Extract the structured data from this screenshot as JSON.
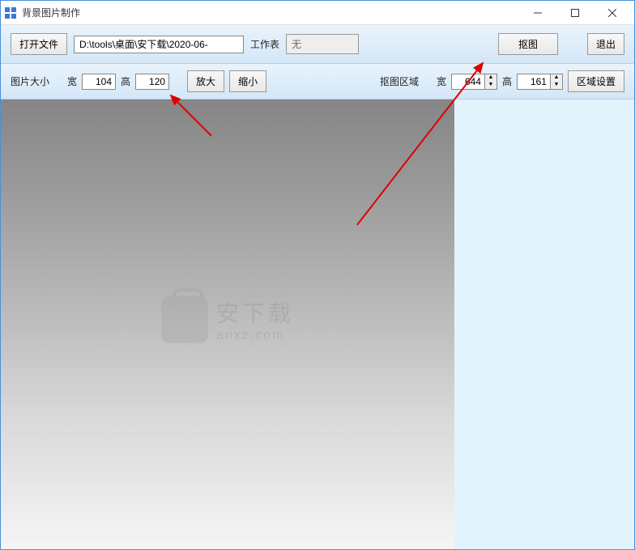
{
  "window": {
    "title": "背景图片制作"
  },
  "toolbar1": {
    "open_file": "打开文件",
    "file_path": "D:\\tools\\桌面\\安下载\\2020-06-",
    "worksheet_label": "工作表",
    "worksheet_value": "无",
    "cutout": "抠图",
    "exit": "退出"
  },
  "toolbar2": {
    "image_size_label": "图片大小",
    "width_label": "宽",
    "width_value": "104",
    "height_label": "高",
    "height_value": "120",
    "zoom_in": "放大",
    "zoom_out": "缩小",
    "cutout_area_label": "抠图区域",
    "cutout_width_label": "宽",
    "cutout_width_value": "644",
    "cutout_height_label": "高",
    "cutout_height_value": "161",
    "area_settings": "区域设置"
  },
  "watermark": {
    "cn": "安下载",
    "en": "anxz.com"
  }
}
